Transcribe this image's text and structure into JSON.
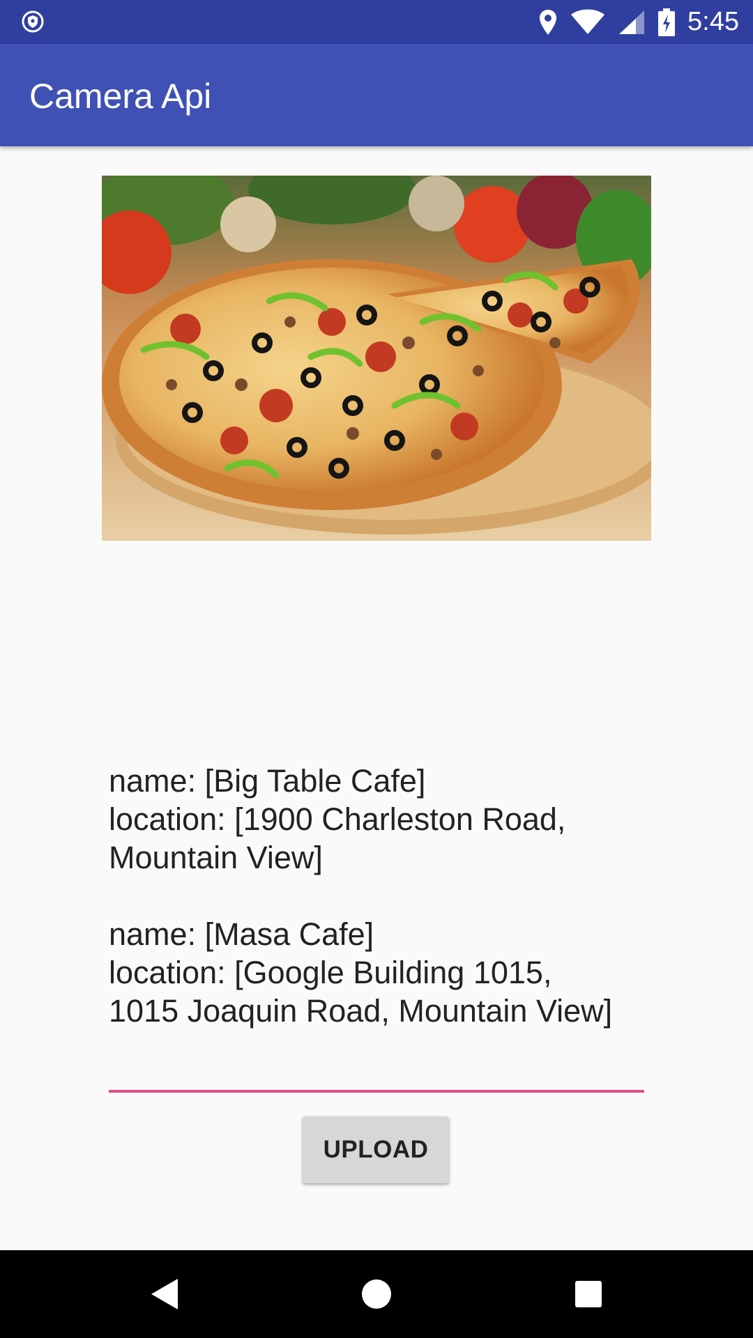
{
  "status_bar": {
    "time": "5:45",
    "icons": [
      "shield-icon",
      "location-icon",
      "wifi-icon",
      "cell-signal-icon",
      "battery-charging-icon"
    ]
  },
  "app_bar": {
    "title": "Camera Api"
  },
  "image": {
    "description_icon": "pizza-photo"
  },
  "results": {
    "line1": "name: [Big Table Cafe]",
    "line2": "location: [1900 Charleston Road,",
    "line3": "Mountain View]",
    "line4": "name: [Masa Cafe]",
    "line5": "location: [Google Building 1015,",
    "line6": "1015 Joaquin Road, Mountain View]"
  },
  "input": {
    "value": "",
    "placeholder": ""
  },
  "upload_button": {
    "label": "UPLOAD"
  },
  "nav_bar": {
    "icons": [
      "back-icon",
      "home-icon",
      "recents-icon"
    ]
  },
  "colors": {
    "status_bar": "#303f9f",
    "app_bar": "#3f51b5",
    "accent": "#e74a87",
    "background": "#fafafa"
  }
}
